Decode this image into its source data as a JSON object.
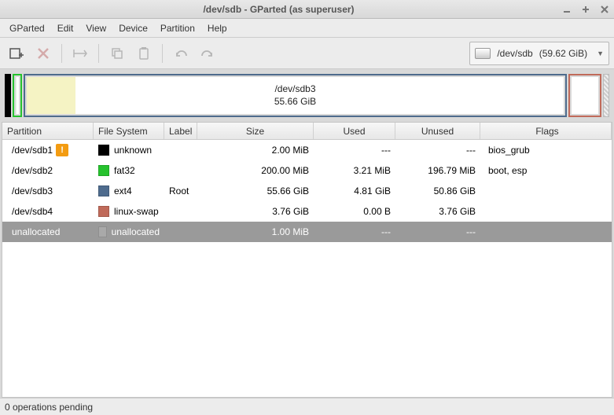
{
  "window": {
    "title": "/dev/sdb - GParted (as superuser)"
  },
  "menu": {
    "items": [
      "GParted",
      "Edit",
      "View",
      "Device",
      "Partition",
      "Help"
    ]
  },
  "device": {
    "name": "/dev/sdb",
    "size": "(59.62 GiB)"
  },
  "map": {
    "main": {
      "name": "/dev/sdb3",
      "size": "55.66 GiB"
    }
  },
  "columns": {
    "partition": "Partition",
    "filesystem": "File System",
    "label": "Label",
    "size": "Size",
    "used": "Used",
    "unused": "Unused",
    "flags": "Flags"
  },
  "rows": [
    {
      "partition": "/dev/sdb1",
      "warn": true,
      "fs": "unknown",
      "fscolor": "#000000",
      "label": "",
      "size": "2.00 MiB",
      "used": "---",
      "unused": "---",
      "flags": "bios_grub"
    },
    {
      "partition": "/dev/sdb2",
      "warn": false,
      "fs": "fat32",
      "fscolor": "#26c22e",
      "label": "",
      "size": "200.00 MiB",
      "used": "3.21 MiB",
      "unused": "196.79 MiB",
      "flags": "boot, esp"
    },
    {
      "partition": "/dev/sdb3",
      "warn": false,
      "fs": "ext4",
      "fscolor": "#4e6b8d",
      "label": "Root",
      "size": "55.66 GiB",
      "used": "4.81 GiB",
      "unused": "50.86 GiB",
      "flags": ""
    },
    {
      "partition": "/dev/sdb4",
      "warn": false,
      "fs": "linux-swap",
      "fscolor": "#c06a5a",
      "label": "",
      "size": "3.76 GiB",
      "used": "0.00 B",
      "unused": "3.76 GiB",
      "flags": ""
    },
    {
      "partition": "unallocated",
      "warn": false,
      "fs": "unallocated",
      "fscolor": "#a9a9a9",
      "label": "",
      "size": "1.00 MiB",
      "used": "---",
      "unused": "---",
      "flags": "",
      "selected": true
    }
  ],
  "status": {
    "text": "0 operations pending"
  }
}
